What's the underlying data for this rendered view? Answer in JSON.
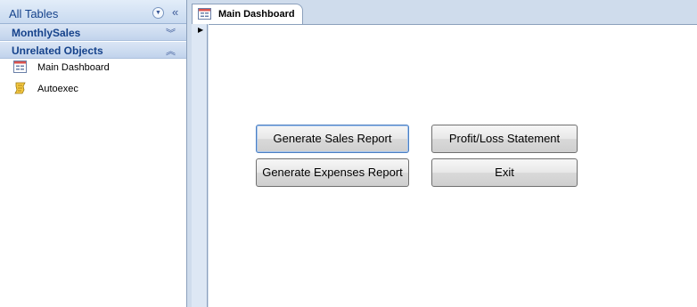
{
  "nav": {
    "title": "All Tables",
    "groups": [
      {
        "label": "MonthlySales",
        "chevron": "expand-icon"
      },
      {
        "label": "Unrelated Objects",
        "chevron": "collapse-icon"
      }
    ],
    "items": [
      {
        "label": "Main Dashboard",
        "icon": "form-icon"
      },
      {
        "label": "Autoexec",
        "icon": "macro-icon"
      }
    ]
  },
  "tab": {
    "label": "Main Dashboard",
    "icon": "form-icon"
  },
  "form": {
    "buttons": {
      "sales": "Generate Sales Report",
      "expenses": "Generate Expenses Report",
      "profit_loss": "Profit/Loss Statement",
      "exit": "Exit"
    }
  },
  "colors": {
    "nav_header": "#c9daf0",
    "group_text": "#15428b",
    "frame": "#cfdcec"
  }
}
